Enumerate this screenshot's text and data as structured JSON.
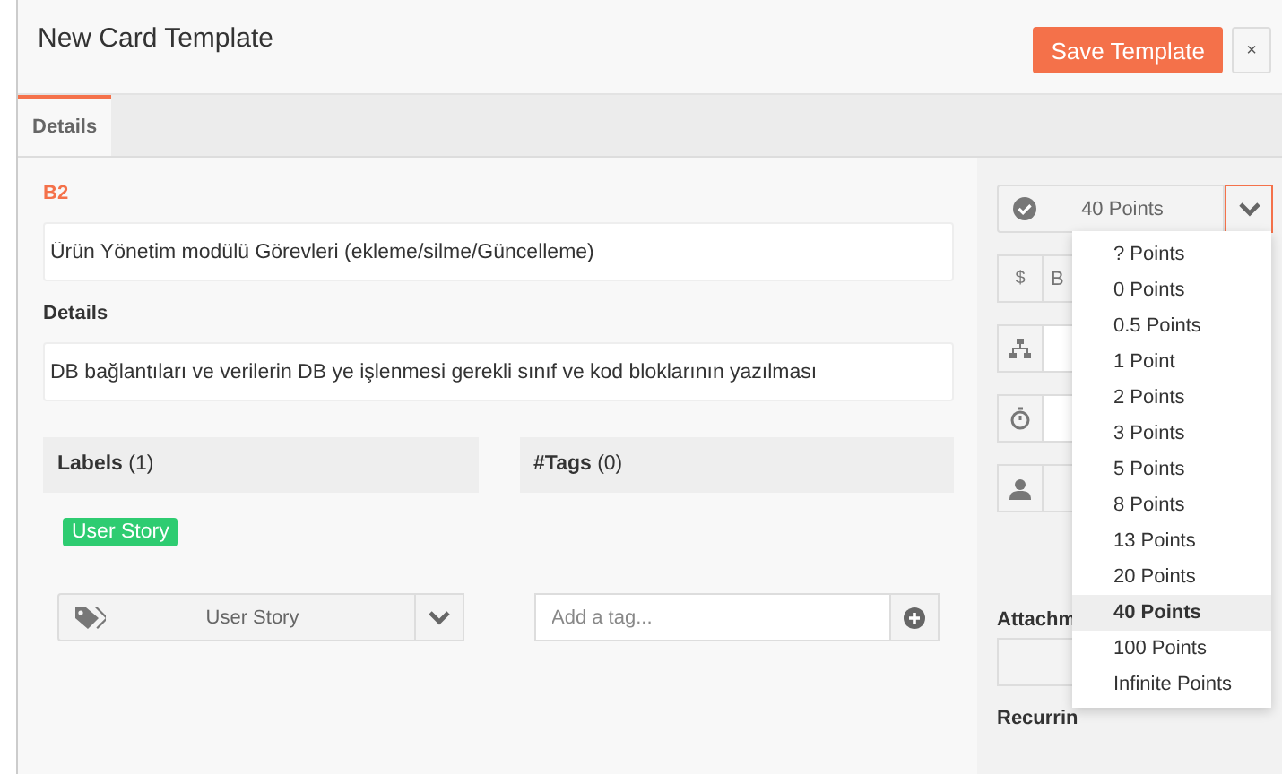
{
  "window": {
    "title": "New Card Template"
  },
  "header_buttons": {
    "save": "Save Template",
    "close": "×"
  },
  "tabs": [
    {
      "label": "Details",
      "selected": true
    }
  ],
  "card": {
    "id": "B2",
    "title": "Ürün Yönetim modülü Görevleri (ekleme/silme/Güncelleme)",
    "details_label": "Details",
    "details": "DB bağlantıları ve verilerin DB ye işlenmesi gerekli sınıf ve kod bloklarının yazılması"
  },
  "labels": {
    "heading": "Labels",
    "count": "(1)",
    "items": [
      {
        "text": "User Story",
        "color": "#2ecc71"
      }
    ],
    "select": "User Story"
  },
  "tags": {
    "heading": "#Tags",
    "count": "(0)",
    "placeholder": "Add a tag..."
  },
  "sidebar": {
    "points": "40 Points",
    "cost_placeholder": "B",
    "cost_symbol": "$",
    "attachments": "Attachm",
    "recurring": "Recurrin"
  },
  "points_menu": {
    "expanded": true,
    "options": [
      {
        "label": "? Points",
        "selected": false
      },
      {
        "label": "0 Points",
        "selected": false
      },
      {
        "label": "0.5 Points",
        "selected": false
      },
      {
        "label": "1 Point",
        "selected": false
      },
      {
        "label": "2 Points",
        "selected": false
      },
      {
        "label": "3 Points",
        "selected": false
      },
      {
        "label": "5 Points",
        "selected": false
      },
      {
        "label": "8 Points",
        "selected": false
      },
      {
        "label": "13 Points",
        "selected": false
      },
      {
        "label": "20 Points",
        "selected": false
      },
      {
        "label": "40 Points",
        "selected": true
      },
      {
        "label": "100 Points",
        "selected": false
      },
      {
        "label": "Infinite Points",
        "selected": false
      }
    ]
  }
}
